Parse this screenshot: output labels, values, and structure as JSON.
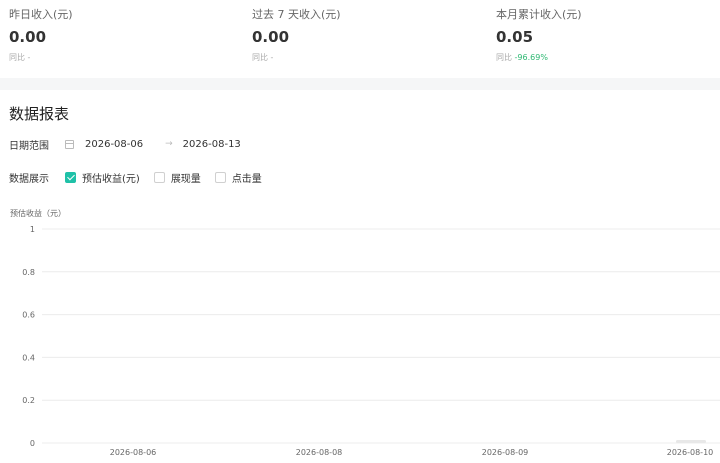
{
  "stats": [
    {
      "label": "昨日收入(元)",
      "value": "0.00",
      "compare_label": "同比",
      "compare_value": "-"
    },
    {
      "label": "过去 7 天收入(元)",
      "value": "0.00",
      "compare_label": "同比",
      "compare_value": "-"
    },
    {
      "label": "本月累计收入(元)",
      "value": "0.05",
      "compare_label": "同比",
      "compare_value": "-96.69%"
    }
  ],
  "colors": {
    "accent": "#1fc1a8",
    "delta_positive": "#2eb872",
    "muted": "#aaaaaa"
  },
  "report": {
    "title": "数据报表",
    "date_range": {
      "label": "日期范围",
      "start": "2026-08-06",
      "separator": "→",
      "end": "2026-08-13"
    },
    "display": {
      "label": "数据展示",
      "options": [
        {
          "label": "预估收益(元)",
          "checked": true
        },
        {
          "label": "展现量",
          "checked": false
        },
        {
          "label": "点击量",
          "checked": false
        }
      ]
    }
  },
  "chart_data": {
    "type": "line",
    "ylabel": "预估收益（元）",
    "ylim": [
      0,
      1
    ],
    "yticks": [
      "1",
      "0.8",
      "0.6",
      "0.4",
      "0.2",
      "0"
    ],
    "categories": [
      "2026-08-06",
      "2026-08-08",
      "2026-08-09",
      "2026-08-10"
    ],
    "series": [],
    "grid": true
  }
}
